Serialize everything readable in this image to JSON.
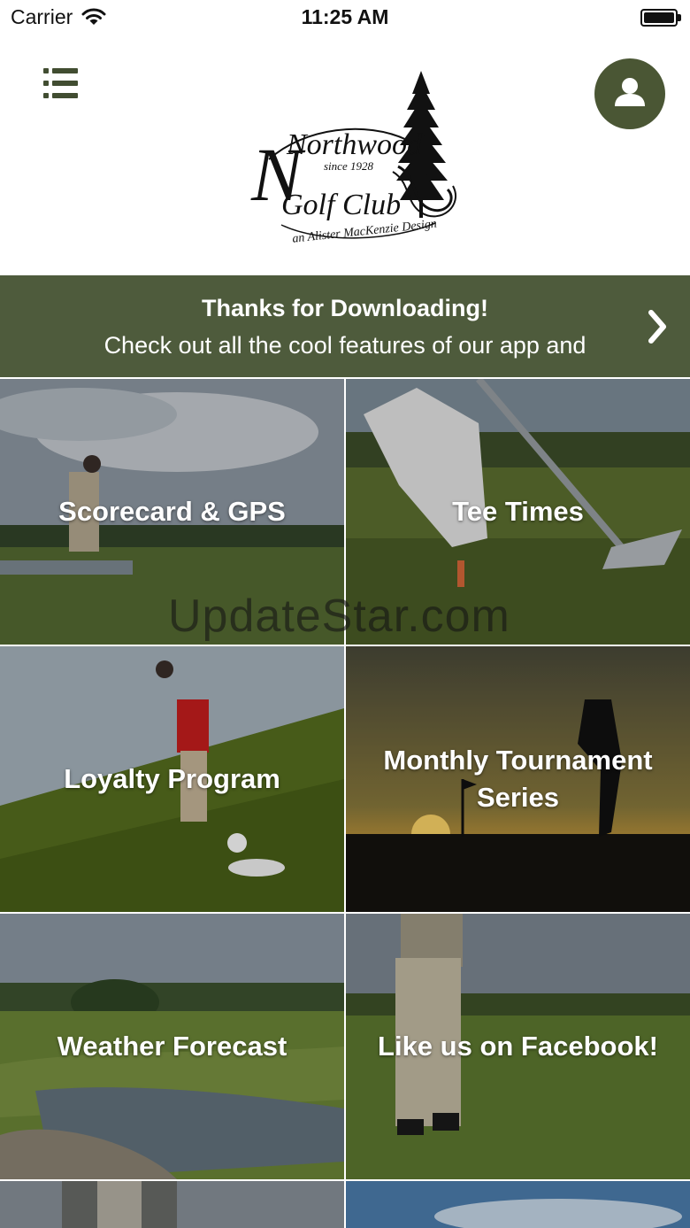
{
  "status_bar": {
    "carrier": "Carrier",
    "time": "11:25 AM"
  },
  "header": {
    "menu_icon": "list-menu-icon",
    "profile_icon": "user-icon",
    "accent_color": "#4a5634",
    "logo": {
      "name": "Northwood",
      "tagline": "since 1928",
      "name_line2": "Golf Club",
      "design_credit": "an Alister MacKenzie Design"
    }
  },
  "banner": {
    "title": "Thanks for Downloading!",
    "text": "Check out all the cool features of our app and",
    "background": "#4e5b3c",
    "chevron_icon": "chevron-right-icon"
  },
  "tiles": [
    {
      "label": "Scorecard & GPS"
    },
    {
      "label": "Tee Times"
    },
    {
      "label": "Loyalty Program"
    },
    {
      "label": "Monthly Tournament\nSeries"
    },
    {
      "label": "Weather Forecast"
    },
    {
      "label": "Like us on Facebook!"
    }
  ],
  "watermark": "UpdateStar.com"
}
